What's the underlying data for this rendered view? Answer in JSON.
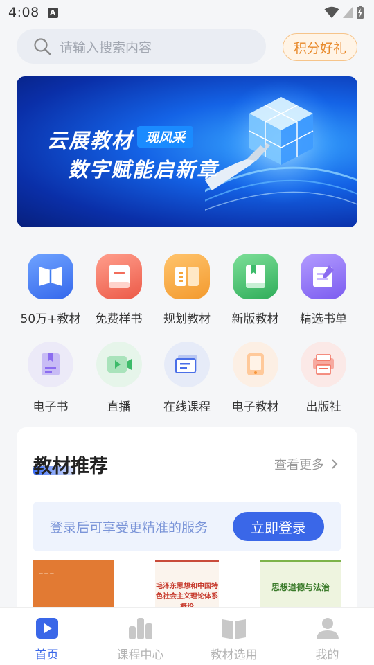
{
  "status_bar": {
    "time": "4:08",
    "badge": "A"
  },
  "search": {
    "placeholder": "请输入搜索内容"
  },
  "points_button": "积分好礼",
  "banner": {
    "line1": "云展教材",
    "tag": "现风采",
    "line2": "数字赋能启新章"
  },
  "grid_row1": [
    {
      "label": "50万+教材",
      "icon": "open-book-icon",
      "color": "#3f7cf0"
    },
    {
      "label": "免费样书",
      "icon": "sample-book-icon",
      "color": "#f26d5b"
    },
    {
      "label": "规划教材",
      "icon": "planned-book-icon",
      "color": "#f6a53a"
    },
    {
      "label": "新版教材",
      "icon": "new-book-icon",
      "color": "#3dbb6a"
    },
    {
      "label": "精选书单",
      "icon": "booklist-icon",
      "color": "#8b6cf0"
    }
  ],
  "grid_row2": [
    {
      "label": "电子书",
      "icon": "ebook-icon",
      "color": "#8b6cf0"
    },
    {
      "label": "直播",
      "icon": "live-icon",
      "color": "#3dbb6a"
    },
    {
      "label": "在线课程",
      "icon": "online-course-icon",
      "color": "#4a6fe8"
    },
    {
      "label": "电子教材",
      "icon": "tablet-icon",
      "color": "#f6953a"
    },
    {
      "label": "出版社",
      "icon": "press-icon",
      "color": "#f26d5b"
    }
  ],
  "recommend": {
    "title": "教材推荐",
    "more": "查看更多",
    "login_text": "登录后可享受更精准的服务",
    "login_button": "立即登录",
    "books": [
      {
        "title": ""
      },
      {
        "title": "毛泽东思想和中国特色社会主义理论体系概论"
      },
      {
        "title": "思想道德与法治"
      }
    ]
  },
  "bottom_nav": [
    {
      "label": "首页",
      "active": true
    },
    {
      "label": "课程中心",
      "active": false
    },
    {
      "label": "教材选用",
      "active": false
    },
    {
      "label": "我的",
      "active": false
    }
  ],
  "colors": {
    "accent": "#3a67e8",
    "points": "#e8892a"
  }
}
